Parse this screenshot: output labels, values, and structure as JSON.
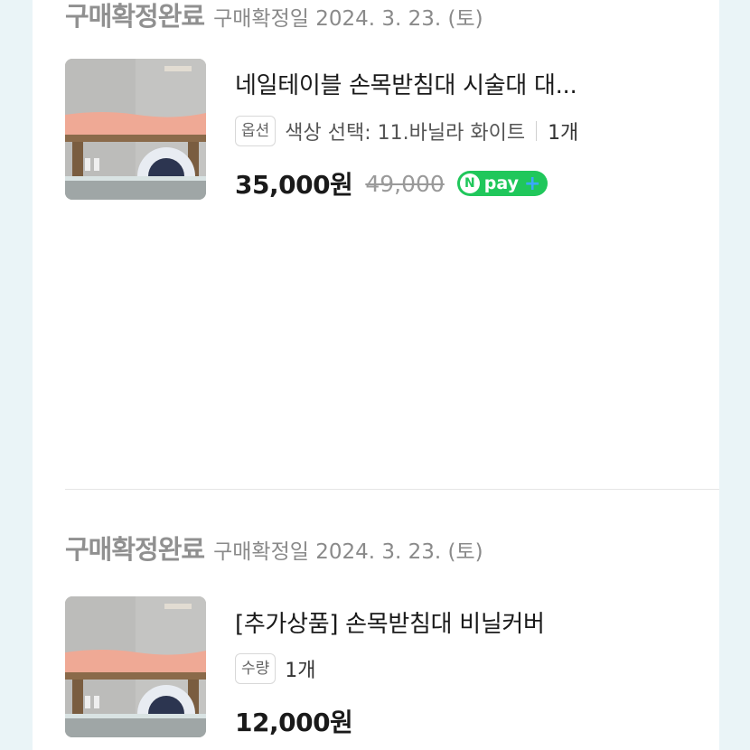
{
  "orders": [
    {
      "status": "구매확정완료",
      "date": "구매확정일 2024. 3. 23. (토)",
      "product_title": "네일테이블 손목받침대 시술대 대...",
      "option_tag": "옵션",
      "option_text": "색상 선택: 11.바닐라 화이트",
      "quantity": "1개",
      "price": "35,000원",
      "original_price": "49,000",
      "npay_label": "pay",
      "npay_n": "N",
      "npay_plus": "+"
    },
    {
      "status": "구매확정완료",
      "date": "구매확정일 2024. 3. 23. (토)",
      "product_title": "[추가상품] 손목받침대 비닐커버",
      "option_tag": "수량",
      "quantity": "1개",
      "price": "12,000원"
    }
  ],
  "colors": {
    "background": "#eaf4f7",
    "npay_green": "#20c75b",
    "status_gray": "#909090"
  }
}
